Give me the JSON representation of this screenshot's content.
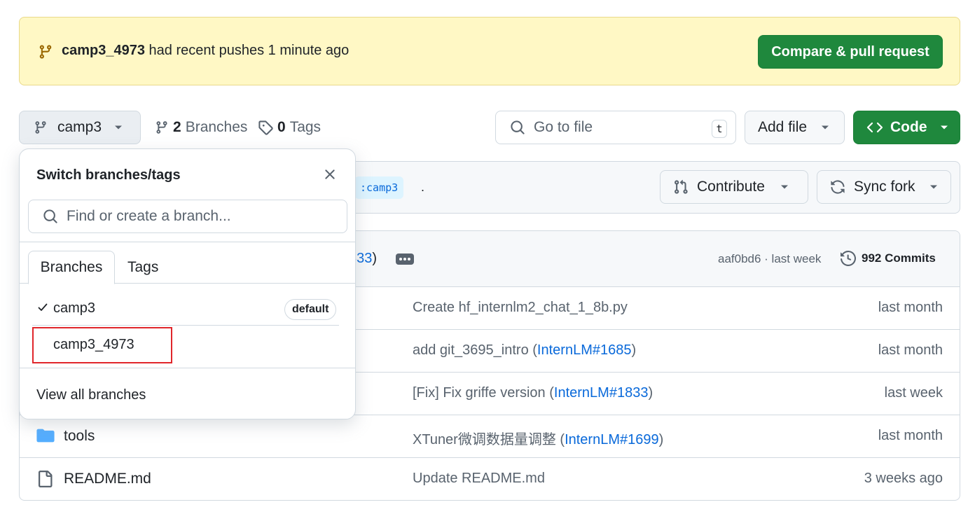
{
  "banner": {
    "branch": "camp3_4973",
    "message": "had recent pushes 1 minute ago",
    "button": "Compare & pull request"
  },
  "toolbar": {
    "current_branch": "camp3",
    "branches_count": "2",
    "branches_label": "Branches",
    "tags_count": "0",
    "tags_label": "Tags",
    "search_placeholder": "Go to file",
    "search_shortcut": "t",
    "add_file": "Add file",
    "code": "Code"
  },
  "fork_bar": {
    "branch_pill": ":camp3",
    "trailing": ".",
    "contribute": "Contribute",
    "sync_fork": "Sync fork"
  },
  "latest_commit": {
    "pr_suffix": "833",
    "close_paren": ")",
    "sha_time": "aaf0bd6 · last week",
    "commits": "992 Commits"
  },
  "files": [
    {
      "name": "",
      "message": "Create hf_internlm2_chat_1_8b.py",
      "link": "",
      "close": "",
      "time": "last month"
    },
    {
      "name": "",
      "message": "add git_3695_intro (",
      "link": "InternLM#1685",
      "close": ")",
      "time": "last month"
    },
    {
      "name": "",
      "message": "[Fix] Fix griffe version (",
      "link": "InternLM#1833",
      "close": ")",
      "time": "last week"
    },
    {
      "name": "tools",
      "message": "XTuner微调数据量调整 (",
      "link": "InternLM#1699",
      "close": ")",
      "time": "last month"
    },
    {
      "name": "README.md",
      "message": "Update README.md",
      "link": "",
      "close": "",
      "time": "3 weeks ago"
    }
  ],
  "dropdown": {
    "title": "Switch branches/tags",
    "search_placeholder": "Find or create a branch...",
    "tab_branches": "Branches",
    "tab_tags": "Tags",
    "branches": [
      {
        "name": "camp3",
        "badge": "default"
      },
      {
        "name": "camp3_4973",
        "badge": ""
      }
    ],
    "view_all": "View all branches"
  },
  "colors": {
    "primary_green": "#1f883d",
    "banner_bg": "#fff8c5",
    "link_blue": "#0969da",
    "highlight_red": "#e0262b"
  }
}
